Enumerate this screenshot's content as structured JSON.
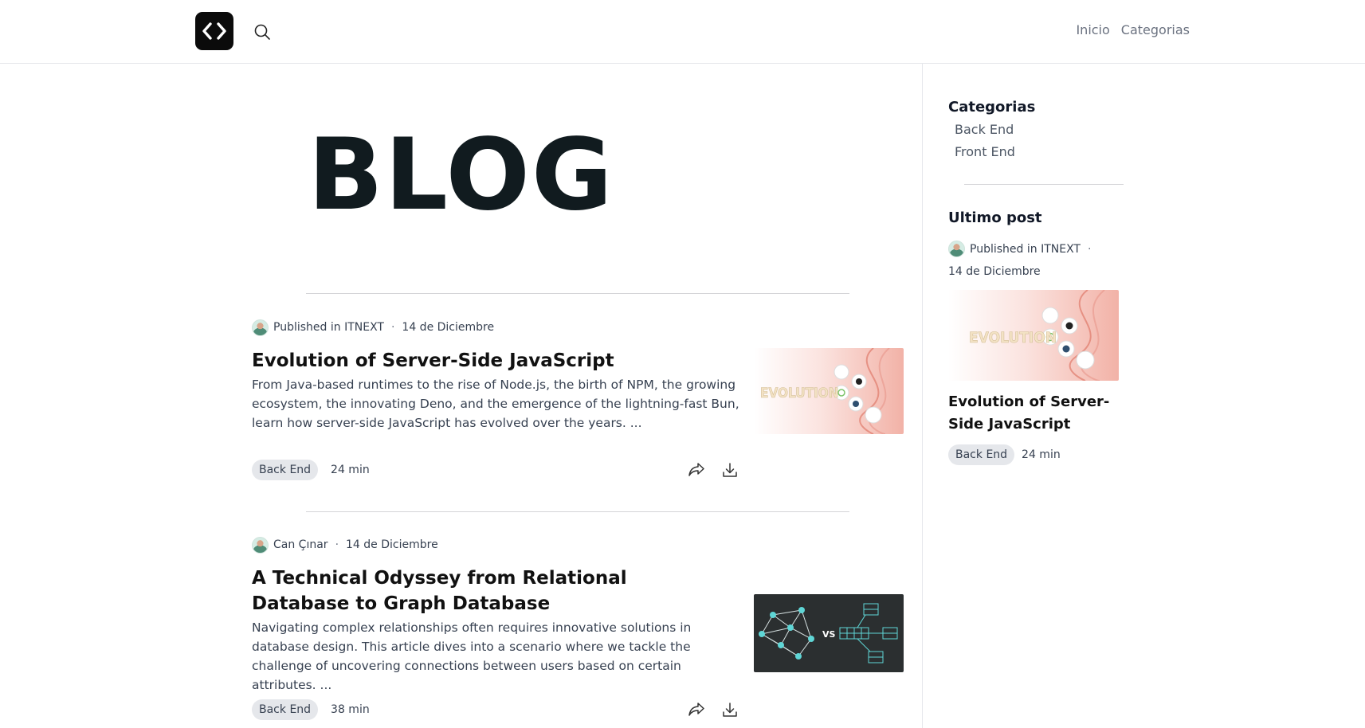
{
  "header": {
    "nav": [
      {
        "label": "Inicio"
      },
      {
        "label": "Categorias"
      }
    ]
  },
  "main": {
    "title": "BLOG",
    "posts": [
      {
        "author": "Published in ITNEXT",
        "date": "14 de Diciembre",
        "title": "Evolution of Server-Side JavaScript",
        "excerpt": "From Java-based runtimes to the rise of Node.js, the birth of NPM, the growing ecosystem, the innovating Deno, and the emergence of the lightning-fast Bun, learn how server-side JavaScript has evolved over the years. ...",
        "tag": "Back End",
        "read_time": "24 min",
        "thumb_text": "EVOLUTION"
      },
      {
        "author": "Can Çınar",
        "date": "14 de Diciembre",
        "title": "A Technical Odyssey from Relational Database to Graph Database",
        "excerpt": "Navigating complex relationships often requires innovative solutions in database design. This article dives into a scenario where we tackle the challenge of uncovering connections between users based on certain attributes. ...",
        "tag": "Back End",
        "read_time": "38 min",
        "thumb_text": "VS"
      }
    ]
  },
  "sidebar": {
    "categories_heading": "Categorias",
    "categories": [
      {
        "label": "Back End"
      },
      {
        "label": "Front End"
      }
    ],
    "latest_heading": "Ultimo post",
    "latest": {
      "author": "Published in ITNEXT",
      "date": "14 de Diciembre",
      "title": "Evolution of Server-Side JavaScript",
      "tag": "Back End",
      "read_time": "24 min",
      "thumb_text": "EVOLUTION"
    }
  },
  "icons": {
    "logo": "code-brackets-icon",
    "search": "search-icon",
    "share": "share-icon",
    "download": "download-icon"
  }
}
